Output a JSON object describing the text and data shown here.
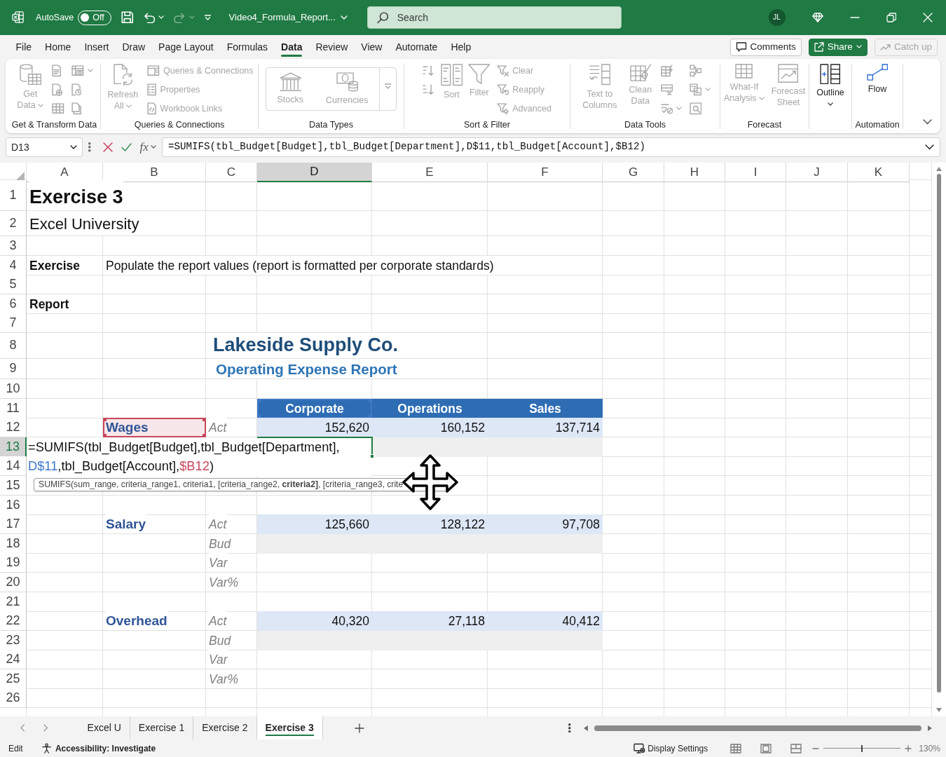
{
  "title_bar": {
    "autosave": {
      "label": "AutoSave",
      "on": false,
      "state_label": "Off"
    },
    "quick_access": [
      {
        "kind": "save",
        "disabled": false
      },
      {
        "kind": "undo",
        "disabled": false,
        "dropdown": true
      },
      {
        "kind": "redo",
        "disabled": true,
        "dropdown": true
      },
      {
        "kind": "customize",
        "disabled": false
      }
    ],
    "file_name": "Video4_Formula_Report...",
    "search": {
      "placeholder": "Search"
    },
    "account": {
      "initials": "JL"
    }
  },
  "menu_tabs": [
    {
      "label": "File",
      "selected": false
    },
    {
      "label": "Home",
      "selected": false
    },
    {
      "label": "Insert",
      "selected": false
    },
    {
      "label": "Draw",
      "selected": false
    },
    {
      "label": "Page Layout",
      "selected": false
    },
    {
      "label": "Formulas",
      "selected": false
    },
    {
      "label": "Data",
      "selected": true
    },
    {
      "label": "Review",
      "selected": false
    },
    {
      "label": "View",
      "selected": false
    },
    {
      "label": "Automate",
      "selected": false
    },
    {
      "label": "Help",
      "selected": false
    }
  ],
  "menu_actions": [
    {
      "kind": "comments",
      "label": "Comments",
      "disabled": false
    },
    {
      "kind": "share",
      "label": "Share",
      "disabled": false,
      "dropdown": true
    },
    {
      "kind": "catchup",
      "label": "Catch up",
      "disabled": true
    }
  ],
  "ribbon": {
    "groups": [
      {
        "label": "Get & Transform Data",
        "columns": [
          {
            "kind": "large",
            "buttons": [
              {
                "kind": "getdata",
                "label": "Get Data",
                "dropdown": true,
                "disabled": true
              }
            ]
          },
          {
            "kind": "stack",
            "buttons": [
              {
                "kind": "fromtext",
                "disabled": true
              },
              {
                "kind": "fromweb",
                "disabled": true
              },
              {
                "kind": "fromtable",
                "disabled": true
              }
            ]
          },
          {
            "kind": "stack",
            "buttons": [
              {
                "kind": "frompicture",
                "dropdown": true,
                "disabled": true
              },
              {
                "kind": "recent",
                "disabled": true
              },
              {
                "kind": "existing",
                "disabled": true
              }
            ]
          }
        ]
      },
      {
        "label": "Queries & Connections",
        "columns": [
          {
            "kind": "large",
            "buttons": [
              {
                "kind": "refresh",
                "label": "Refresh All",
                "dropdown": true,
                "disabled": true
              }
            ]
          },
          {
            "kind": "stack",
            "buttons": [
              {
                "kind": "queries",
                "label": "Queries & Connections",
                "disabled": true
              },
              {
                "kind": "properties",
                "label": "Properties",
                "disabled": true
              },
              {
                "kind": "links",
                "label": "Workbook Links",
                "disabled": true
              }
            ]
          }
        ]
      },
      {
        "label": "Data Types",
        "columns": [
          {
            "kind": "gallery",
            "buttons": [
              {
                "kind": "stocks",
                "label": "Stocks",
                "disabled": true
              },
              {
                "kind": "currencies",
                "label": "Currencies",
                "disabled": true
              },
              {
                "kind": "more",
                "disabled": true
              }
            ]
          }
        ]
      },
      {
        "label": "Sort & Filter",
        "columns": [
          {
            "kind": "stack",
            "buttons": [
              {
                "kind": "sortaz",
                "disabled": true
              },
              {
                "kind": "sortza",
                "disabled": true
              }
            ]
          },
          {
            "kind": "large",
            "buttons": [
              {
                "kind": "sort",
                "label": "Sort",
                "disabled": true
              }
            ]
          },
          {
            "kind": "large",
            "buttons": [
              {
                "kind": "filter",
                "label": "Filter",
                "disabled": true
              }
            ]
          },
          {
            "kind": "stack",
            "buttons": [
              {
                "kind": "clear",
                "label": "Clear",
                "disabled": true
              },
              {
                "kind": "reapply",
                "label": "Reapply",
                "disabled": true
              },
              {
                "kind": "advanced",
                "label": "Advanced",
                "disabled": true
              }
            ]
          }
        ]
      },
      {
        "label": "Data Tools",
        "columns": [
          {
            "kind": "large",
            "buttons": [
              {
                "kind": "textcolumns",
                "label": "Text to Columns",
                "disabled": true
              }
            ]
          },
          {
            "kind": "large",
            "buttons": [
              {
                "kind": "cleandata",
                "label": "Clean Data",
                "disabled": true
              }
            ]
          },
          {
            "kind": "stack",
            "buttons": [
              {
                "kind": "flashfill",
                "disabled": true
              },
              {
                "kind": "duplicates",
                "disabled": true
              },
              {
                "kind": "validation",
                "dropdown": true,
                "disabled": true
              }
            ]
          },
          {
            "kind": "stack",
            "buttons": [
              {
                "kind": "consolidate",
                "disabled": true
              },
              {
                "kind": "relationships",
                "dropdown": true,
                "disabled": true
              },
              {
                "kind": "datamodel",
                "disabled": true
              }
            ]
          }
        ]
      },
      {
        "label": "Forecast",
        "columns": [
          {
            "kind": "large",
            "buttons": [
              {
                "kind": "whatif",
                "label": "What-If Analysis",
                "dropdown": true,
                "disabled": true
              }
            ]
          },
          {
            "kind": "large",
            "buttons": [
              {
                "kind": "forecast",
                "label": "Forecast Sheet",
                "disabled": true
              }
            ]
          }
        ]
      },
      {
        "columns": [
          {
            "kind": "large",
            "buttons": [
              {
                "kind": "outline",
                "label": "Outline",
                "dropdown": true,
                "disabled": false
              }
            ]
          }
        ]
      },
      {
        "label": "Automation",
        "columns": [
          {
            "kind": "large",
            "buttons": [
              {
                "kind": "flow",
                "label": "Flow",
                "disabled": false
              }
            ]
          }
        ]
      }
    ]
  },
  "formula_bar": {
    "name_box": "D13",
    "function_label": "fx",
    "formula": "=SUMIFS(tbl_Budget[Budget],tbl_Budget[Department],D$11,tbl_Budget[Account],$B12)"
  },
  "sheet": {
    "columns": [
      {
        "label": "A",
        "selected": false
      },
      {
        "label": "B",
        "selected": false
      },
      {
        "label": "C",
        "selected": false
      },
      {
        "label": "D",
        "selected": true
      },
      {
        "label": "E",
        "selected": false
      },
      {
        "label": "F",
        "selected": false
      },
      {
        "label": "G",
        "selected": false
      },
      {
        "label": "H",
        "selected": false
      },
      {
        "label": "I",
        "selected": false
      },
      {
        "label": "J",
        "selected": false
      },
      {
        "label": "K",
        "selected": false
      }
    ],
    "rows": [
      {
        "number": "1",
        "selected": false,
        "cells": {
          "A": {
            "kind": "title",
            "text": "Exercise 3"
          }
        }
      },
      {
        "number": "2",
        "selected": false,
        "cells": {
          "A": {
            "kind": "subtitle",
            "text": "Excel University"
          }
        }
      },
      {
        "number": "3",
        "selected": false
      },
      {
        "number": "4",
        "selected": false,
        "cells": {
          "A": {
            "kind": "label",
            "text": "Exercise"
          },
          "B": {
            "kind": "text",
            "text": "Populate the report values (report is formatted per corporate standards)"
          }
        }
      },
      {
        "number": "5",
        "selected": false
      },
      {
        "number": "6",
        "selected": false,
        "cells": {
          "A": {
            "kind": "label",
            "text": "Report"
          }
        }
      },
      {
        "number": "7",
        "selected": false
      },
      {
        "number": "8",
        "selected": false,
        "cells": {
          "C": {
            "kind": "company",
            "text": "Lakeside Supply Co."
          }
        }
      },
      {
        "number": "9",
        "selected": false,
        "cells": {
          "C": {
            "kind": "report_title",
            "text": "Operating Expense Report"
          }
        }
      },
      {
        "number": "10",
        "selected": false
      },
      {
        "number": "11",
        "selected": false,
        "cells": {
          "D": {
            "kind": "column_header",
            "text": "Corporate",
            "color": "#3f78c9"
          },
          "E": {
            "kind": "column_header",
            "text": "Operations"
          },
          "F": {
            "kind": "column_header",
            "text": "Sales"
          }
        }
      },
      {
        "number": "12",
        "selected": false,
        "cells": {
          "B": {
            "kind": "account",
            "text": "Wages",
            "color": "#c8475b"
          },
          "C": {
            "kind": "measure",
            "text": "Act"
          },
          "D": {
            "kind": "actual",
            "text": "152,620"
          },
          "E": {
            "kind": "actual",
            "text": "160,152"
          },
          "F": {
            "kind": "actual",
            "text": "137,714"
          }
        }
      },
      {
        "number": "13",
        "selected": true,
        "cells": {
          "E": {
            "kind": "budget"
          },
          "F": {
            "kind": "budget"
          }
        }
      },
      {
        "number": "14",
        "selected": false
      },
      {
        "number": "15",
        "selected": false
      },
      {
        "number": "16",
        "selected": false
      },
      {
        "number": "17",
        "selected": false,
        "cells": {
          "B": {
            "kind": "account",
            "text": "Salary"
          },
          "C": {
            "kind": "measure",
            "text": "Act"
          },
          "D": {
            "kind": "actual",
            "text": "125,660"
          },
          "E": {
            "kind": "actual",
            "text": "128,122"
          },
          "F": {
            "kind": "actual",
            "text": "97,708"
          }
        }
      },
      {
        "number": "18",
        "selected": false,
        "cells": {
          "C": {
            "kind": "measure",
            "text": "Bud"
          },
          "D": {
            "kind": "budget"
          },
          "E": {
            "kind": "budget"
          },
          "F": {
            "kind": "budget"
          }
        }
      },
      {
        "number": "19",
        "selected": false,
        "cells": {
          "C": {
            "kind": "measure",
            "text": "Var"
          }
        }
      },
      {
        "number": "20",
        "selected": false,
        "cells": {
          "C": {
            "kind": "measure",
            "text": "Var%"
          }
        }
      },
      {
        "number": "21",
        "selected": false
      },
      {
        "number": "22",
        "selected": false,
        "cells": {
          "B": {
            "kind": "account",
            "text": "Overhead"
          },
          "C": {
            "kind": "measure",
            "text": "Act"
          },
          "D": {
            "kind": "actual",
            "text": "40,320"
          },
          "E": {
            "kind": "actual",
            "text": "27,118"
          },
          "F": {
            "kind": "actual",
            "text": "40,412"
          }
        }
      },
      {
        "number": "23",
        "selected": false,
        "cells": {
          "C": {
            "kind": "measure",
            "text": "Bud"
          },
          "D": {
            "kind": "budget"
          },
          "E": {
            "kind": "budget"
          },
          "F": {
            "kind": "budget"
          }
        }
      },
      {
        "number": "24",
        "selected": false,
        "cells": {
          "C": {
            "kind": "measure",
            "text": "Var"
          }
        }
      },
      {
        "number": "25",
        "selected": false,
        "cells": {
          "C": {
            "kind": "measure",
            "text": "Var%"
          }
        }
      },
      {
        "number": "26",
        "selected": false
      }
    ]
  },
  "cell_editor": {
    "segments": [
      {
        "text": "=SUMIFS(tbl_Budget[Budget],tbl_Budget[Department],"
      },
      {
        "text": "D$11",
        "color": "#3f78c9"
      },
      {
        "text": ",tbl_Budget[Account],"
      },
      {
        "text": "$B12",
        "color": "#c8475b"
      },
      {
        "text": ")"
      }
    ]
  },
  "function_tooltip": "SUMIFS(sum_range, criteria_range1, criteria1, [criteria_range2, **criteria2]**, [criteria_range3, crite",
  "sheet_tabs": [
    {
      "label": "Excel U",
      "selected": false
    },
    {
      "label": "Exercise 1",
      "selected": false
    },
    {
      "label": "Exercise 2",
      "selected": false
    },
    {
      "label": "Exercise 3",
      "selected": true
    }
  ],
  "status_bar": {
    "mode": "Edit",
    "accessibility": "Accessibility: Investigate",
    "display_settings": "Display Settings",
    "zoom": {
      "level": 0.5,
      "reading": "130%"
    }
  }
}
